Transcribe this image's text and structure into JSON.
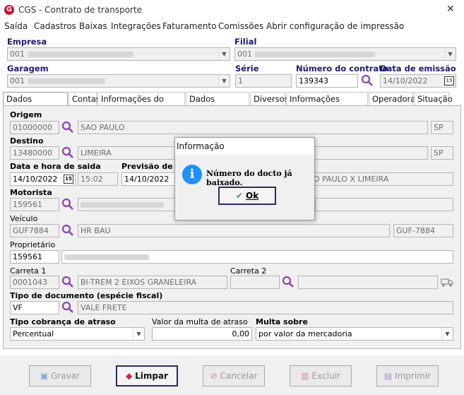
{
  "window": {
    "title": "CGS - Contrato de transporte",
    "logo": "G"
  },
  "menu": [
    "Saída",
    "Cadastros",
    "Baixas",
    "Integrações",
    "Faturamento",
    "Comissões",
    "Abrir configuração de impressão"
  ],
  "header": {
    "empresa_label": "Empresa",
    "empresa_code": "001",
    "filial_label": "Filial",
    "filial_code": "001",
    "garagem_label": "Garagem",
    "garagem_code": "001",
    "serie_label": "Série",
    "serie_value": "1",
    "numero_label": "Número do contrato",
    "numero_value": "139343",
    "emissao_label": "Data de emissão",
    "emissao_value": "14/10/2022"
  },
  "tabs": [
    "Dados cadastrais",
    "Contas",
    "Informações do contrato",
    "Dados Bancários",
    "Diversos",
    "Informações adicionais",
    "Operadoras",
    "Situação"
  ],
  "form": {
    "origem_label": "Origem",
    "origem_code": "01000000",
    "origem_city": "SAO PAULO",
    "origem_uf": "SP",
    "destino_label": "Destino",
    "destino_code": "13480000",
    "destino_city": "LIMEIRA",
    "destino_uf": "SP",
    "saida_label": "Data e hora de saida",
    "saida_date": "14/10/2022",
    "saida_time": "15:02",
    "previsao_label": "Previsão de c",
    "previsao_date": "14/10/2022",
    "rota": "O PAULO X LIMEIRA",
    "motorista_label": "Motorista",
    "motorista_code": "159561",
    "veiculo_label": "Veículo",
    "veiculo_code": "GUF7884",
    "veiculo_desc": "HR BAU",
    "veiculo_plate": "GUF-7884",
    "proprietario_label": "Proprietário",
    "proprietario_code": "159561",
    "carreta1_label": "Carreta 1",
    "carreta1_code": "0001043",
    "carreta1_desc": "BI-TREM 2 EIXOS GRANELEIRA",
    "carreta2_label": "Carreta 2",
    "tipodoc_label": "Tipo de documento (espécie fiscal)",
    "tipodoc_code": "VF",
    "tipodoc_desc": "VALE FRETE",
    "cobranca_label": "Tipo cobrança de atraso",
    "cobranca_value": "Percentual",
    "multa_label": "Valor da multa de atraso",
    "multa_value": "0,00",
    "multasobre_label": "Multa sobre",
    "multasobre_value": "por valor da mercadoria"
  },
  "buttons": {
    "gravar": "Gravar",
    "limpar": "Limpar",
    "cancelar": "Cancelar",
    "excluir": "Excluir",
    "imprimir": "Imprimir"
  },
  "dialog": {
    "title": "Informação",
    "message": "Número do docto já baixado.",
    "ok": "Ok"
  }
}
